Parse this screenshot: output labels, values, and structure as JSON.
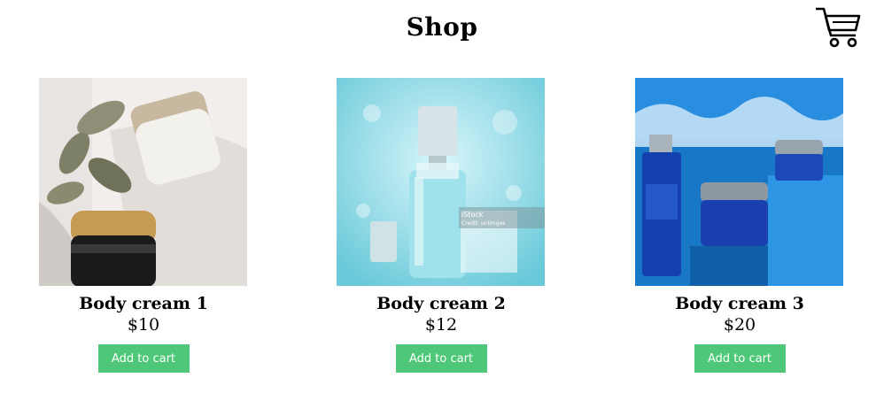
{
  "header": {
    "title": "Shop",
    "cart_icon": "shopping-cart-icon"
  },
  "colors": {
    "button_bg": "#4ec878",
    "button_text": "#ffffff"
  },
  "products": [
    {
      "name": "Body cream 1",
      "price": "$10",
      "button_label": "Add to cart",
      "image": "cream-jars-photo"
    },
    {
      "name": "Body cream 2",
      "price": "$12",
      "button_label": "Add to cart",
      "image": "serum-bottle-photo",
      "watermark": "iStock",
      "watermark_sub": "Credit: unlimges"
    },
    {
      "name": "Body cream 3",
      "price": "$20",
      "button_label": "Add to cart",
      "image": "skincare-set-photo"
    }
  ]
}
